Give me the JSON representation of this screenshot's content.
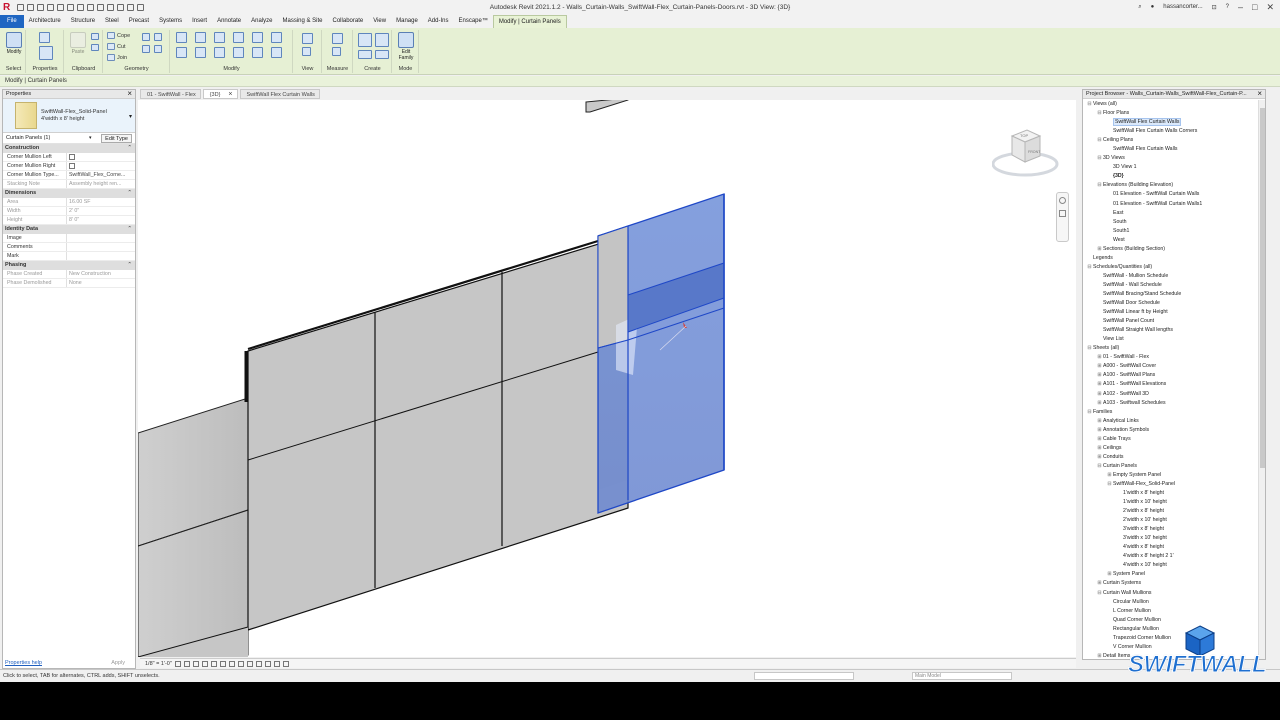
{
  "titlebar": {
    "title": "Autodesk Revit 2021.1.2 - Walls_Curtain-Walls_SwiftWall-Flex_Curtain-Panels-Doors.rvt - 3D View: {3D}",
    "user": "hassancorter..."
  },
  "tabs": [
    {
      "label": "File",
      "kind": "file"
    },
    {
      "label": "Architecture",
      "kind": ""
    },
    {
      "label": "Structure",
      "kind": ""
    },
    {
      "label": "Steel",
      "kind": ""
    },
    {
      "label": "Precast",
      "kind": ""
    },
    {
      "label": "Systems",
      "kind": ""
    },
    {
      "label": "Insert",
      "kind": ""
    },
    {
      "label": "Annotate",
      "kind": ""
    },
    {
      "label": "Analyze",
      "kind": ""
    },
    {
      "label": "Massing & Site",
      "kind": ""
    },
    {
      "label": "Collaborate",
      "kind": ""
    },
    {
      "label": "View",
      "kind": ""
    },
    {
      "label": "Manage",
      "kind": ""
    },
    {
      "label": "Add-Ins",
      "kind": ""
    },
    {
      "label": "Enscape™",
      "kind": ""
    },
    {
      "label": "Modify | Curtain Panels",
      "kind": "active"
    }
  ],
  "ribbon": {
    "modify": "Modify",
    "cope": "Cope",
    "cut": "Cut",
    "join": "Join",
    "paste": "Paste",
    "edit_family": "Edit Family",
    "groups": {
      "select": "Select",
      "properties": "Properties",
      "clipboard": "Clipboard",
      "geometry": "Geometry",
      "modify": "Modify",
      "view": "View",
      "measure": "Measure",
      "create": "Create",
      "mode": "Mode"
    }
  },
  "context_label": "Modify | Curtain Panels",
  "properties": {
    "header": "Properties",
    "type_name_1": "SwiftWall-Flex_Solid-Panel",
    "type_name_2": "4'width x 8' height",
    "instance": "Curtain Panels (1)",
    "edit_type": "Edit Type",
    "help": "Properties help",
    "apply": "Apply",
    "sections": [
      {
        "title": "Construction",
        "rows": [
          {
            "name": "Corner Mullion Left",
            "value": "",
            "check": true,
            "grey": false
          },
          {
            "name": "Corner Mullion Right",
            "value": "",
            "check": true,
            "grey": false
          },
          {
            "name": "Corner Mullion Type...",
            "value": "SwiftWall_Flex_Corne...",
            "check": false,
            "grey": false
          },
          {
            "name": "Stacking Note",
            "value": "Assembly height ren...",
            "check": false,
            "grey": true
          }
        ]
      },
      {
        "title": "Dimensions",
        "rows": [
          {
            "name": "Area",
            "value": "16.00 SF",
            "check": false,
            "grey": true
          },
          {
            "name": "Width",
            "value": "2' 0\"",
            "check": false,
            "grey": true
          },
          {
            "name": "Height",
            "value": "8' 0\"",
            "check": false,
            "grey": true
          }
        ]
      },
      {
        "title": "Identity Data",
        "rows": [
          {
            "name": "Image",
            "value": "",
            "check": false,
            "grey": false
          },
          {
            "name": "Comments",
            "value": "",
            "check": false,
            "grey": false
          },
          {
            "name": "Mark",
            "value": "",
            "check": false,
            "grey": false
          }
        ]
      },
      {
        "title": "Phasing",
        "rows": [
          {
            "name": "Phase Created",
            "value": "New Construction",
            "check": false,
            "grey": true
          },
          {
            "name": "Phase Demolished",
            "value": "None",
            "check": false,
            "grey": true
          }
        ]
      }
    ]
  },
  "view_tabs": [
    {
      "label": "01 - SwiftWall - Flex",
      "active": false,
      "closable": false
    },
    {
      "label": "{3D}",
      "active": true,
      "closable": true
    },
    {
      "label": "SwiftWall Flex Curtain Walls",
      "active": false,
      "closable": false
    }
  ],
  "viewcube": {
    "top": "TOP",
    "front": "FRONT"
  },
  "view_scale": "1/8\" = 1'-0\"",
  "project_browser": {
    "header": "Project Browser - Walls_Curtain-Walls_SwiftWall-Flex_Curtain-P...",
    "items": [
      {
        "label": "Views (all)",
        "level": 0,
        "toggle": "⊟",
        "selected": false,
        "bold": false
      },
      {
        "label": "Floor Plans",
        "level": 1,
        "toggle": "⊟",
        "selected": false,
        "bold": false
      },
      {
        "label": "SwiftWall Flex Curtain Walls",
        "level": 2,
        "toggle": "",
        "selected": true,
        "bold": false
      },
      {
        "label": "SwiftWall Flex Curtain Walls Corners",
        "level": 2,
        "toggle": "",
        "selected": false,
        "bold": false
      },
      {
        "label": "Ceiling Plans",
        "level": 1,
        "toggle": "⊟",
        "selected": false,
        "bold": false
      },
      {
        "label": "SwiftWall Flex Curtain Walls",
        "level": 2,
        "toggle": "",
        "selected": false,
        "bold": false
      },
      {
        "label": "3D Views",
        "level": 1,
        "toggle": "⊟",
        "selected": false,
        "bold": false
      },
      {
        "label": "3D View 1",
        "level": 2,
        "toggle": "",
        "selected": false,
        "bold": false
      },
      {
        "label": "{3D}",
        "level": 2,
        "toggle": "",
        "selected": false,
        "bold": true
      },
      {
        "label": "Elevations (Building Elevation)",
        "level": 1,
        "toggle": "⊟",
        "selected": false,
        "bold": false
      },
      {
        "label": "01 Elevation - SwiftWall Curtain Walls",
        "level": 2,
        "toggle": "",
        "selected": false,
        "bold": false
      },
      {
        "label": "01 Elevation - SwiftWall Curtain Walls1",
        "level": 2,
        "toggle": "",
        "selected": false,
        "bold": false
      },
      {
        "label": "East",
        "level": 2,
        "toggle": "",
        "selected": false,
        "bold": false
      },
      {
        "label": "South",
        "level": 2,
        "toggle": "",
        "selected": false,
        "bold": false
      },
      {
        "label": "South1",
        "level": 2,
        "toggle": "",
        "selected": false,
        "bold": false
      },
      {
        "label": "West",
        "level": 2,
        "toggle": "",
        "selected": false,
        "bold": false
      },
      {
        "label": "Sections (Building Section)",
        "level": 1,
        "toggle": "⊞",
        "selected": false,
        "bold": false
      },
      {
        "label": "Legends",
        "level": 0,
        "toggle": "",
        "selected": false,
        "bold": false
      },
      {
        "label": "Schedules/Quantities (all)",
        "level": 0,
        "toggle": "⊟",
        "selected": false,
        "bold": false
      },
      {
        "label": "SwiftWall - Mullion Schedule",
        "level": 1,
        "toggle": "",
        "selected": false,
        "bold": false
      },
      {
        "label": "SwiftWall - Wall Schedule",
        "level": 1,
        "toggle": "",
        "selected": false,
        "bold": false
      },
      {
        "label": "SwiftWall Bracing/Stand Schedule",
        "level": 1,
        "toggle": "",
        "selected": false,
        "bold": false
      },
      {
        "label": "SwiftWall Door Schedule",
        "level": 1,
        "toggle": "",
        "selected": false,
        "bold": false
      },
      {
        "label": "SwiftWall Linear ft by Height",
        "level": 1,
        "toggle": "",
        "selected": false,
        "bold": false
      },
      {
        "label": "SwiftWall Panel Count",
        "level": 1,
        "toggle": "",
        "selected": false,
        "bold": false
      },
      {
        "label": "SwiftWall Straight Wall lengths",
        "level": 1,
        "toggle": "",
        "selected": false,
        "bold": false
      },
      {
        "label": "View List",
        "level": 1,
        "toggle": "",
        "selected": false,
        "bold": false
      },
      {
        "label": "Sheets (all)",
        "level": 0,
        "toggle": "⊟",
        "selected": false,
        "bold": false
      },
      {
        "label": "01 - SwiftWall - Flex",
        "level": 1,
        "toggle": "⊞",
        "selected": false,
        "bold": false
      },
      {
        "label": "A000 - SwiftWall Cover",
        "level": 1,
        "toggle": "⊞",
        "selected": false,
        "bold": false
      },
      {
        "label": "A100 - SwiftWall Plans",
        "level": 1,
        "toggle": "⊞",
        "selected": false,
        "bold": false
      },
      {
        "label": "A101 - SwiftWall Elevations",
        "level": 1,
        "toggle": "⊞",
        "selected": false,
        "bold": false
      },
      {
        "label": "A102 - SwiftWall 3D",
        "level": 1,
        "toggle": "⊞",
        "selected": false,
        "bold": false
      },
      {
        "label": "A103 - Swiftwall Schedules",
        "level": 1,
        "toggle": "⊞",
        "selected": false,
        "bold": false
      },
      {
        "label": "Families",
        "level": 0,
        "toggle": "⊟",
        "selected": false,
        "bold": false
      },
      {
        "label": "Analytical Links",
        "level": 1,
        "toggle": "⊞",
        "selected": false,
        "bold": false
      },
      {
        "label": "Annotation Symbols",
        "level": 1,
        "toggle": "⊞",
        "selected": false,
        "bold": false
      },
      {
        "label": "Cable Trays",
        "level": 1,
        "toggle": "⊞",
        "selected": false,
        "bold": false
      },
      {
        "label": "Ceilings",
        "level": 1,
        "toggle": "⊞",
        "selected": false,
        "bold": false
      },
      {
        "label": "Conduits",
        "level": 1,
        "toggle": "⊞",
        "selected": false,
        "bold": false
      },
      {
        "label": "Curtain Panels",
        "level": 1,
        "toggle": "⊟",
        "selected": false,
        "bold": false
      },
      {
        "label": "Empty System Panel",
        "level": 2,
        "toggle": "⊞",
        "selected": false,
        "bold": false
      },
      {
        "label": "SwiftWall-Flex_Solid-Panel",
        "level": 2,
        "toggle": "⊟",
        "selected": false,
        "bold": false
      },
      {
        "label": "1'width x 8' height",
        "level": 3,
        "toggle": "",
        "selected": false,
        "bold": false
      },
      {
        "label": "1'width x 10' height",
        "level": 3,
        "toggle": "",
        "selected": false,
        "bold": false
      },
      {
        "label": "2'width x 8' height",
        "level": 3,
        "toggle": "",
        "selected": false,
        "bold": false
      },
      {
        "label": "2'width x 10' height",
        "level": 3,
        "toggle": "",
        "selected": false,
        "bold": false
      },
      {
        "label": "3'width x 8' height",
        "level": 3,
        "toggle": "",
        "selected": false,
        "bold": false
      },
      {
        "label": "3'width x 10' height",
        "level": 3,
        "toggle": "",
        "selected": false,
        "bold": false
      },
      {
        "label": "4'width x 8' height",
        "level": 3,
        "toggle": "",
        "selected": false,
        "bold": false
      },
      {
        "label": "4'width x 8' height 2 1'",
        "level": 3,
        "toggle": "",
        "selected": false,
        "bold": false
      },
      {
        "label": "4'width x 10' height",
        "level": 3,
        "toggle": "",
        "selected": false,
        "bold": false
      },
      {
        "label": "System Panel",
        "level": 2,
        "toggle": "⊞",
        "selected": false,
        "bold": false
      },
      {
        "label": "Curtain Systems",
        "level": 1,
        "toggle": "⊞",
        "selected": false,
        "bold": false
      },
      {
        "label": "Curtain Wall Mullions",
        "level": 1,
        "toggle": "⊟",
        "selected": false,
        "bold": false
      },
      {
        "label": "Circular Mullion",
        "level": 2,
        "toggle": "",
        "selected": false,
        "bold": false
      },
      {
        "label": "L Corner Mullion",
        "level": 2,
        "toggle": "",
        "selected": false,
        "bold": false
      },
      {
        "label": "Quad Corner Mullion",
        "level": 2,
        "toggle": "",
        "selected": false,
        "bold": false
      },
      {
        "label": "Rectangular Mullion",
        "level": 2,
        "toggle": "",
        "selected": false,
        "bold": false
      },
      {
        "label": "Trapezoid Corner Mullion",
        "level": 2,
        "toggle": "",
        "selected": false,
        "bold": false
      },
      {
        "label": "V Corner Mullion",
        "level": 2,
        "toggle": "",
        "selected": false,
        "bold": false
      },
      {
        "label": "Detail Items",
        "level": 1,
        "toggle": "⊞",
        "selected": false,
        "bold": false
      }
    ]
  },
  "status": {
    "message": "Click to select, TAB for alternates, CTRL adds, SHIFT unselects.",
    "model": "Main Model"
  },
  "watermark": "SWIFTWALL",
  "colors": {
    "selection_blue": "#3d68c8",
    "ribbon_green": "#e6f0d4",
    "file_tab": "#1f66c2"
  }
}
